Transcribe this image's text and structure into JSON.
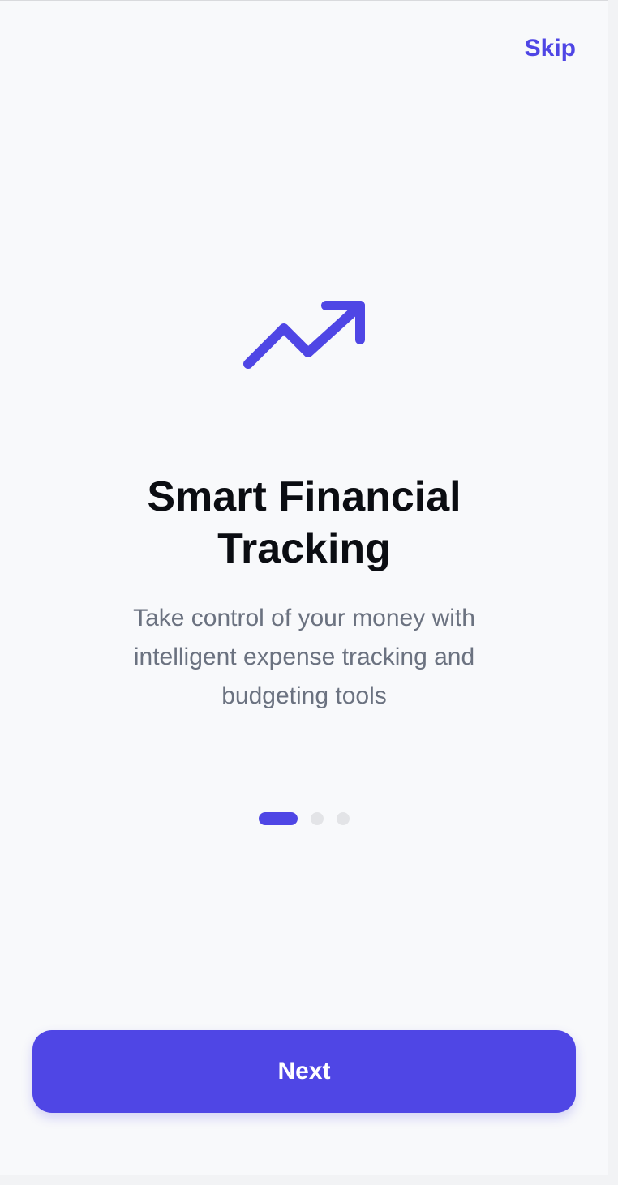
{
  "header": {
    "skip_label": "Skip"
  },
  "hero": {
    "icon": "trending-up-icon",
    "title": "Smart Financial Tracking",
    "description": "Take control of your money with intelligent expense tracking and budgeting tools"
  },
  "pager": {
    "current_page": 1,
    "total_pages": 3
  },
  "footer": {
    "next_label": "Next"
  },
  "colors": {
    "accent": "#4f46e5",
    "background": "#f8f9fb",
    "title_text": "#0b0d12",
    "body_text": "#6b7280",
    "inactive_dot": "#e3e4e7"
  }
}
